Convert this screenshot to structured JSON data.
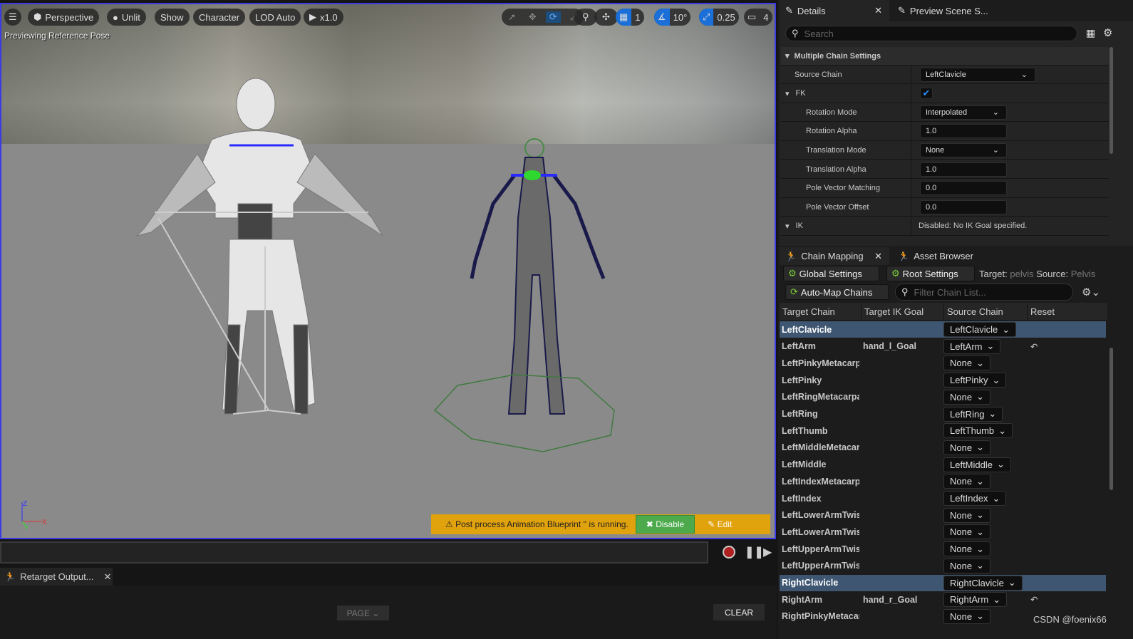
{
  "viewport": {
    "toolbar": {
      "menu_icon": "hamburger-icon",
      "perspective": "Perspective",
      "unlit": "Unlit",
      "show": "Show",
      "character": "Character",
      "lod": "LOD Auto",
      "play_speed": "x1.0",
      "grid_snap": "1",
      "rotation_snap": "10°",
      "scale_snap": "0.25",
      "camera_speed": "4"
    },
    "status": "Previewing Reference Pose",
    "axes": {
      "z": "Z",
      "x": "X",
      "y": "Y"
    },
    "warning": {
      "text": "Post process Animation Blueprint '' is running.",
      "disable": "Disable",
      "edit": "Edit",
      "color": "#e0a20d"
    }
  },
  "details": {
    "tabs": [
      {
        "label": "Details"
      },
      {
        "label": "Preview Scene S..."
      }
    ],
    "search_placeholder": "Search",
    "section": "Multiple Chain Settings",
    "properties": [
      {
        "label": "Source Chain",
        "value": "LeftClavicle",
        "type": "dropdown"
      },
      {
        "label": "FK",
        "value": "",
        "type": "checkbox",
        "checked": true
      },
      {
        "label": "Rotation Mode",
        "value": "Interpolated",
        "type": "dropdown"
      },
      {
        "label": "Rotation Alpha",
        "value": "1.0",
        "type": "number"
      },
      {
        "label": "Translation Mode",
        "value": "None",
        "type": "dropdown"
      },
      {
        "label": "Translation Alpha",
        "value": "1.0",
        "type": "number"
      },
      {
        "label": "Pole Vector Matching",
        "value": "0.0",
        "type": "number"
      },
      {
        "label": "Pole Vector Offset",
        "value": "0.0",
        "type": "number"
      },
      {
        "label": "IK",
        "value": "Disabled: No IK Goal specified.",
        "type": "text"
      }
    ]
  },
  "chain_mapping": {
    "tabs": [
      {
        "label": "Chain Mapping"
      },
      {
        "label": "Asset Browser"
      }
    ],
    "global_settings": "Global Settings",
    "root_settings": "Root Settings",
    "target_label": "Target:",
    "target_value": "pelvis",
    "source_label": "Source:",
    "source_value": "Pelvis",
    "auto_map": "Auto-Map Chains",
    "filter_placeholder": "Filter Chain List...",
    "columns": [
      "Target Chain",
      "Target IK Goal",
      "Source Chain",
      "Reset"
    ],
    "rows": [
      {
        "target": "LeftClavicle",
        "goal": "",
        "source": "LeftClavicle",
        "selected": true
      },
      {
        "target": "LeftArm",
        "goal": "hand_l_Goal",
        "source": "LeftArm",
        "reset": true
      },
      {
        "target": "LeftPinkyMetacarpal",
        "goal": "",
        "source": "None"
      },
      {
        "target": "LeftPinky",
        "goal": "",
        "source": "LeftPinky"
      },
      {
        "target": "LeftRingMetacarpal",
        "goal": "",
        "source": "None"
      },
      {
        "target": "LeftRing",
        "goal": "",
        "source": "LeftRing"
      },
      {
        "target": "LeftThumb",
        "goal": "",
        "source": "LeftThumb"
      },
      {
        "target": "LeftMiddleMetacarpal",
        "goal": "",
        "source": "None"
      },
      {
        "target": "LeftMiddle",
        "goal": "",
        "source": "LeftMiddle"
      },
      {
        "target": "LeftIndexMetacarpal",
        "goal": "",
        "source": "None"
      },
      {
        "target": "LeftIndex",
        "goal": "",
        "source": "LeftIndex"
      },
      {
        "target": "LeftLowerArmTwist",
        "goal": "",
        "source": "None"
      },
      {
        "target": "LeftLowerArmTwist",
        "goal": "",
        "source": "None"
      },
      {
        "target": "LeftUpperArmTwist",
        "goal": "",
        "source": "None"
      },
      {
        "target": "LeftUpperArmTwist",
        "goal": "",
        "source": "None"
      },
      {
        "target": "RightClavicle",
        "goal": "",
        "source": "RightClavicle",
        "selected": true
      },
      {
        "target": "RightArm",
        "goal": "hand_r_Goal",
        "source": "RightArm",
        "reset": true
      },
      {
        "target": "RightPinkyMetacarpal",
        "goal": "",
        "source": "None"
      }
    ]
  },
  "output": {
    "tab": "Retarget Output...",
    "page": "PAGE",
    "clear": "CLEAR"
  },
  "watermark": "CSDN @foenix66"
}
